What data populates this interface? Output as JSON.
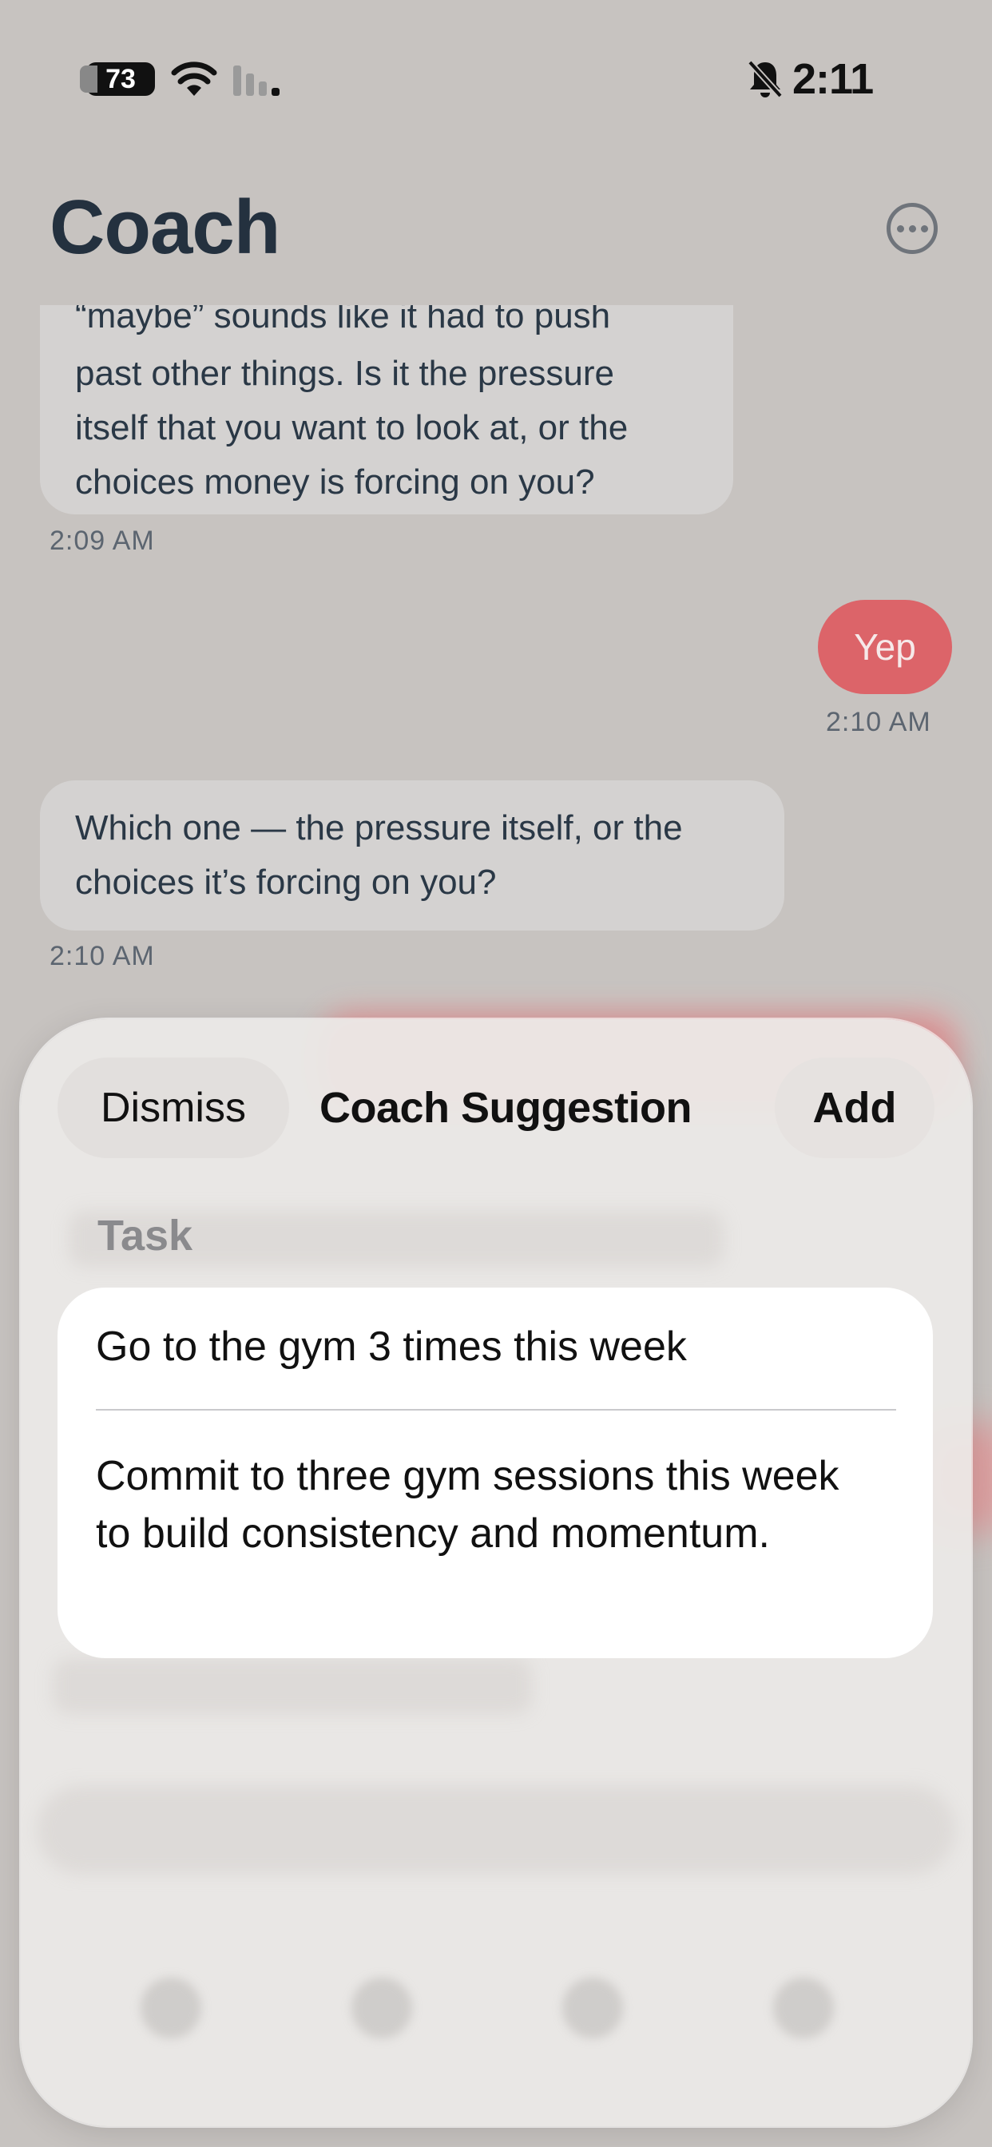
{
  "status_bar": {
    "battery": "73",
    "time": "2:11"
  },
  "header": {
    "title": "Coach"
  },
  "chat": {
    "messages": [
      {
        "role": "coach",
        "lines": [
          "“maybe” sounds like it had to push",
          "past other things. Is it the pressure",
          "itself that you want to look at, or the",
          "choices money is forcing on you?"
        ],
        "time": "2:09 AM"
      },
      {
        "role": "user",
        "text": "Yep",
        "time": "2:10 AM"
      },
      {
        "role": "coach",
        "lines": [
          "Which one — the pressure itself, or the",
          "choices it’s forcing on you?"
        ],
        "time": "2:10 AM"
      }
    ]
  },
  "sheet": {
    "dismiss_label": "Dismiss",
    "title": "Coach Suggestion",
    "add_label": "Add",
    "section_label": "Task",
    "task_title": "Go to the gym 3 times this week",
    "task_description": "Commit to three gym sessions this week to build consistency and momentum."
  },
  "colors": {
    "user_bubble": "#dc6469",
    "coach_bubble": "#d4d2d1",
    "background": "#c7c3c0"
  },
  "icons": [
    "wifi-icon",
    "cellular-signal-icon",
    "bell-slash-icon",
    "more-options-icon"
  ]
}
